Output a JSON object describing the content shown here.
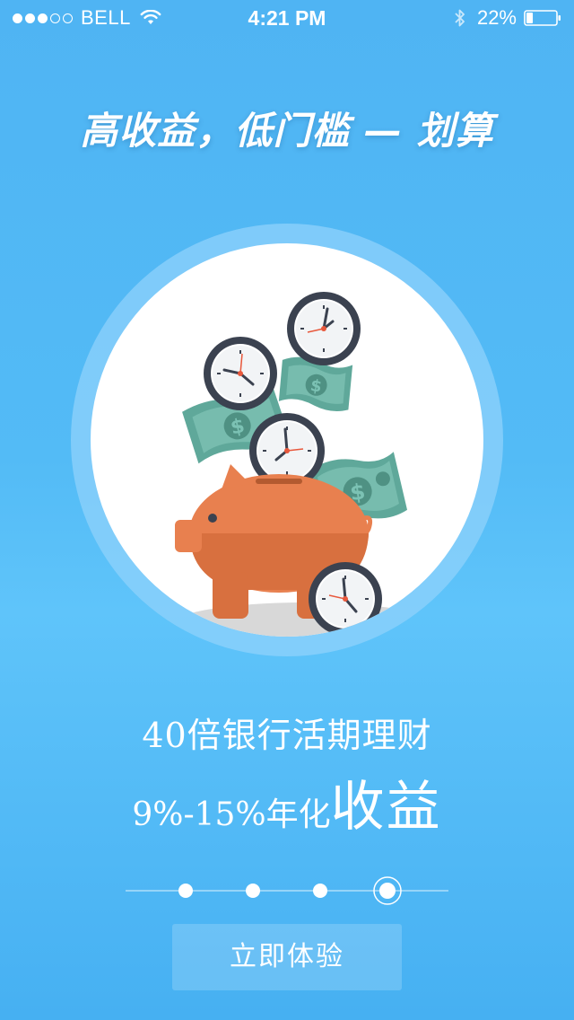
{
  "status_bar": {
    "carrier": "BELL",
    "signal_bars_filled": 3,
    "signal_bars_total": 5,
    "time": "4:21 PM",
    "battery_percent": "22%",
    "battery_level": 0.22
  },
  "headline": "高收益，低门槛 — 划算",
  "illustration": {
    "icons": [
      "piggy-bank-icon",
      "clock-icon",
      "banknote-icon"
    ]
  },
  "description": {
    "line1": "40倍银行活期理财",
    "line2_prefix": "9%-15%年化",
    "line2_emphasis": "收益"
  },
  "pager": {
    "page_count": 4,
    "current_page": 4
  },
  "cta_label": "立即体验",
  "colors": {
    "background": "#4fb4f3",
    "pig": "#e8804f",
    "pig_dark": "#d8703f",
    "banknote": "#5fa89a",
    "clock_rim": "#3b4250",
    "clock_hand_accent": "#e8583c"
  }
}
